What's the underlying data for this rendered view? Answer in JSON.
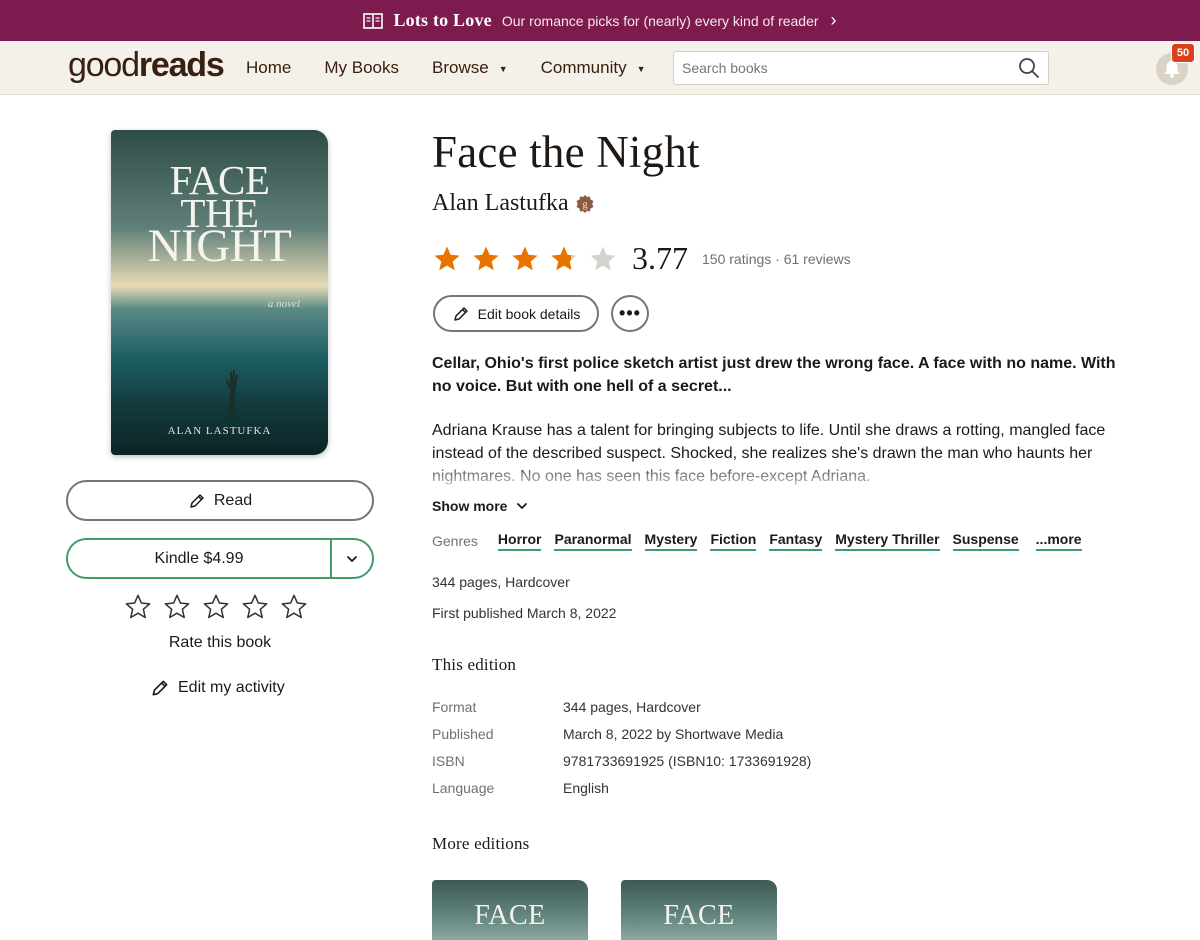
{
  "promo": {
    "title": "Lots to Love",
    "text": "Our romance picks for (nearly) every kind of reader",
    "chevron": "›",
    "icon": "open-book-icon"
  },
  "header": {
    "logo_good": "good",
    "logo_reads": "reads",
    "nav": [
      "Home",
      "My Books",
      "Browse",
      "Community"
    ],
    "nav_dropdown_caret": "▼",
    "search_placeholder": "Search books",
    "notifications_count": "50"
  },
  "cover": {
    "title_line1": "FACE",
    "title_line2": "THE",
    "title_line3": "NIGHT",
    "novel_tag": "a novel",
    "author": "ALAN LASTUFKA"
  },
  "actions": {
    "read_label": "Read",
    "kindle_label": "Kindle $4.99",
    "rate_label": "Rate this book",
    "edit_activity_label": "Edit my activity",
    "user_rating_stars": 5
  },
  "book": {
    "title": "Face the Night",
    "author": "Alan Lastufka",
    "average_rating": "3.77",
    "rating_value": 3.77,
    "counts": "150 ratings · 61 reviews",
    "edit_details_label": "Edit book details",
    "more_label": "•••",
    "description_lead": "Cellar, Ohio's first police sketch artist just drew the wrong face. A face with no name. With no voice. But with one hell of a secret...",
    "description_body": "Adriana Krause has a talent for bringing subjects to life. Until she draws a rotting, mangled face instead of the described suspect. Shocked, she realizes she's drawn the man who haunts her nightmares. No one has seen this face before-except Adriana.",
    "show_more_label": "Show more",
    "genres_label": "Genres",
    "genres": [
      "Horror",
      "Paranormal",
      "Mystery",
      "Fiction",
      "Fantasy",
      "Mystery Thriller",
      "Suspense"
    ],
    "genres_more": "...more",
    "pages_format": "344 pages, Hardcover",
    "first_published": "First published March 8, 2022"
  },
  "edition": {
    "section_title": "This edition",
    "rows": [
      {
        "key": "Format",
        "value": "344 pages, Hardcover"
      },
      {
        "key": "Published",
        "value": "March 8, 2022 by Shortwave Media"
      },
      {
        "key": "ISBN",
        "value": "9781733691925 (ISBN10: 1733691928)"
      },
      {
        "key": "Language",
        "value": "English"
      }
    ]
  },
  "more_editions": {
    "section_title": "More editions",
    "covers": [
      "FACE",
      "FACE"
    ]
  },
  "colors": {
    "promo_bg": "#7d1a4e",
    "header_bg": "#f4f1ea",
    "star_orange": "#e87400",
    "star_empty": "#d6d2cc",
    "kindle_green": "#409d69",
    "badge_red": "#d9411e"
  }
}
